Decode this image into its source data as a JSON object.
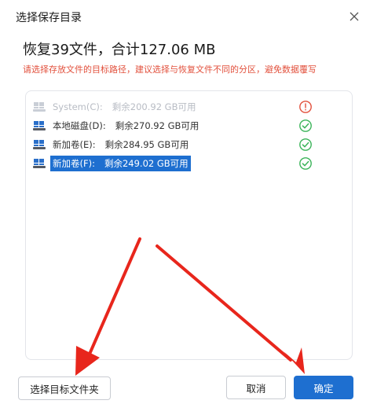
{
  "dialog": {
    "title": "选择保存目录",
    "heading": "恢复39文件，合计127.06 MB",
    "warning": "请选择存放文件的目标路径，建议选择与恢复文件不同的分区，避免数据覆写"
  },
  "drives": [
    {
      "name": "System(C):",
      "space": "剩余200.92 GB可用",
      "state": "disabled",
      "status_icon": "warning-circle-icon",
      "status_color": "#e2503c"
    },
    {
      "name": "本地磁盘(D):",
      "space": "剩余270.92 GB可用",
      "state": "available",
      "status_icon": "check-circle-icon",
      "status_color": "#3cb45a"
    },
    {
      "name": "新加卷(E):",
      "space": "剩余284.95 GB可用",
      "state": "available",
      "status_icon": "check-circle-icon",
      "status_color": "#3cb45a"
    },
    {
      "name": "新加卷(F):",
      "space": "剩余249.02 GB可用",
      "state": "selected",
      "status_icon": "check-circle-icon",
      "status_color": "#3cb45a"
    }
  ],
  "buttons": {
    "choose_folder": "选择目标文件夹",
    "cancel": "取消",
    "confirm": "确定"
  },
  "colors": {
    "accent": "#1e6fd0",
    "warning_text": "#e2503c",
    "annotation_arrow": "#e8261c"
  }
}
